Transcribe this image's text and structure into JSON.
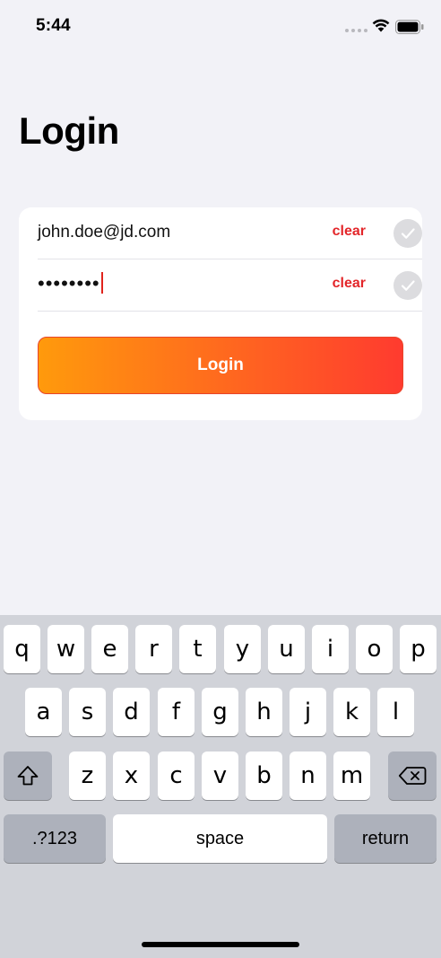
{
  "status_bar": {
    "time": "5:44"
  },
  "title": "Login",
  "form": {
    "email_value": "john.doe@jd.com",
    "password_value": "••••••••",
    "clear_label": "clear",
    "login_label": "Login"
  },
  "colors": {
    "accent_red": "#e3262a",
    "gradient_start": "#ff9a0c",
    "gradient_end": "#ff3b2f"
  },
  "keyboard": {
    "row1": [
      "q",
      "w",
      "e",
      "r",
      "t",
      "y",
      "u",
      "i",
      "o",
      "p"
    ],
    "row2": [
      "a",
      "s",
      "d",
      "f",
      "g",
      "h",
      "j",
      "k",
      "l"
    ],
    "row3": [
      "z",
      "x",
      "c",
      "v",
      "b",
      "n",
      "m"
    ],
    "shift_icon": "shift-icon",
    "delete_icon": "delete-icon",
    "numbers_label": ".?123",
    "space_label": "space",
    "return_label": "return"
  }
}
